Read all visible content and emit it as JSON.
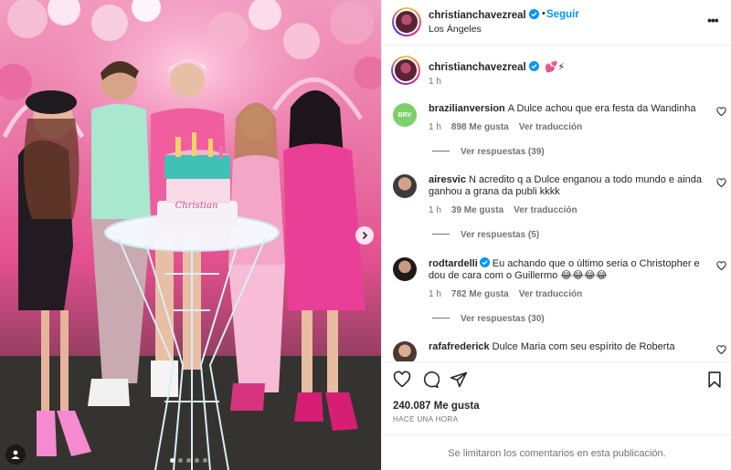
{
  "header": {
    "username": "christianchavezreal",
    "follow_label": "Seguir",
    "location": "Los Ángeles"
  },
  "caption": {
    "username": "christianchavezreal",
    "emoji": "💕⚡",
    "time": "1 h"
  },
  "photo": {
    "cake_text": "Christian",
    "carousel_dots": 5,
    "active_dot": 0
  },
  "comments": [
    {
      "username": "brazilianversion",
      "avatar_text": "BRV",
      "text": "A Dulce achou que era festa da Wandinha",
      "time": "1 h",
      "likes": "898 Me gusta",
      "translate": "Ver traducción",
      "replies": "Ver respuestas (39)",
      "verified": false
    },
    {
      "username": "airesvic",
      "text": "N acredito q a Dulce enganou a todo mundo e ainda ganhou a grana da publi kkkk",
      "time": "1 h",
      "likes": "39 Me gusta",
      "translate": "Ver traducción",
      "replies": "Ver respuestas (5)",
      "verified": false
    },
    {
      "username": "rodtardelli",
      "text": "Eu achando que o último seria o Christopher e dou de cara com o Guillermo 😂😂😂😂",
      "time": "1 h",
      "likes": "782 Me gusta",
      "translate": "Ver traducción",
      "replies": "Ver respuestas (30)",
      "verified": true
    },
    {
      "username": "rafafrederick",
      "text": "Dulce Maria com seu espírito de Roberta",
      "verified": false
    }
  ],
  "actions": {
    "likes": "240.087 Me gusta",
    "posted": "HACE UNA HORA"
  },
  "footer": {
    "comments_limited": "Se limitaron los comentarios en esta publicación."
  },
  "colors": {
    "accent": "#0095f6",
    "text": "#262626",
    "muted": "#737373",
    "divider": "#efefef"
  },
  "icons": [
    "verified-icon",
    "more-options-icon",
    "heart-icon",
    "comment-icon",
    "share-icon",
    "bookmark-icon",
    "chevron-right-icon",
    "user-tag-icon"
  ]
}
